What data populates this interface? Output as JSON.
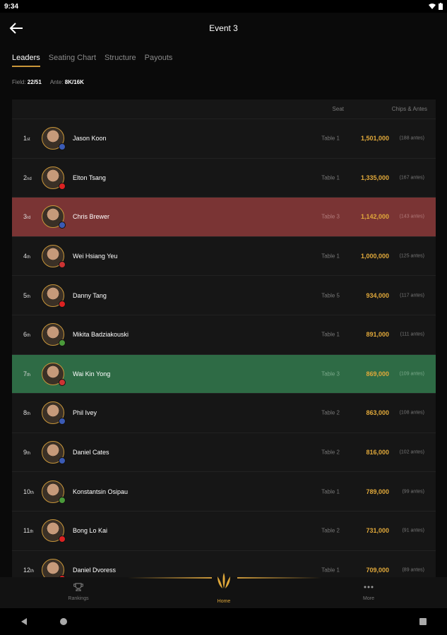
{
  "status": {
    "time": "9:34"
  },
  "header": {
    "title": "Event 3"
  },
  "tabs": [
    {
      "label": "Leaders"
    },
    {
      "label": "Seating Chart"
    },
    {
      "label": "Structure"
    },
    {
      "label": "Payouts"
    }
  ],
  "field": {
    "field_label": "Field:",
    "field_value": "22/51",
    "ante_label": "Ante:",
    "ante_value": "8K/16K"
  },
  "table": {
    "col_seat": "Seat",
    "col_chips": "Chips & Antes",
    "rows": [
      {
        "rank": "1",
        "suffix": "st",
        "name": "Jason Koon",
        "seat": "Table 1",
        "chips": "1,501,000",
        "antes": "(188 antes)",
        "flag": "#3b5bb5"
      },
      {
        "rank": "2",
        "suffix": "nd",
        "name": "Elton Tsang",
        "seat": "Table 1",
        "chips": "1,335,000",
        "antes": "(167 antes)",
        "flag": "#d22"
      },
      {
        "rank": "3",
        "suffix": "rd",
        "name": "Chris Brewer",
        "seat": "Table 3",
        "chips": "1,142,000",
        "antes": "(143 antes)",
        "flag": "#3b5bb5"
      },
      {
        "rank": "4",
        "suffix": "th",
        "name": "Wei Hsiang Yeu",
        "seat": "Table 1",
        "chips": "1,000,000",
        "antes": "(125 antes)",
        "flag": "#c33"
      },
      {
        "rank": "5",
        "suffix": "th",
        "name": "Danny Tang",
        "seat": "Table 5",
        "chips": "934,000",
        "antes": "(117 antes)",
        "flag": "#d22"
      },
      {
        "rank": "6",
        "suffix": "th",
        "name": "Mikita Badziakouski",
        "seat": "Table 1",
        "chips": "891,000",
        "antes": "(111 antes)",
        "flag": "#4a9a3a"
      },
      {
        "rank": "7",
        "suffix": "th",
        "name": "Wai Kin Yong",
        "seat": "Table 3",
        "chips": "869,000",
        "antes": "(109 antes)",
        "flag": "#c33"
      },
      {
        "rank": "8",
        "suffix": "th",
        "name": "Phil Ivey",
        "seat": "Table 2",
        "chips": "863,000",
        "antes": "(108 antes)",
        "flag": "#3b5bb5"
      },
      {
        "rank": "9",
        "suffix": "th",
        "name": "Daniel Cates",
        "seat": "Table 2",
        "chips": "816,000",
        "antes": "(102 antes)",
        "flag": "#3b5bb5"
      },
      {
        "rank": "10",
        "suffix": "th",
        "name": "Konstantsin Osipau",
        "seat": "Table 1",
        "chips": "789,000",
        "antes": "(99 antes)",
        "flag": "#4a9a3a"
      },
      {
        "rank": "11",
        "suffix": "th",
        "name": "Bong Lo Kai",
        "seat": "Table 2",
        "chips": "731,000",
        "antes": "(91 antes)",
        "flag": "#d22"
      },
      {
        "rank": "12",
        "suffix": "th",
        "name": "Daniel Dvoress",
        "seat": "Table 1",
        "chips": "709,000",
        "antes": "(89 antes)",
        "flag": "#d22"
      }
    ]
  },
  "bottom_nav": [
    {
      "label": "Rankings",
      "icon": "trophy-icon"
    },
    {
      "label": "Home",
      "icon": "home-logo-icon"
    },
    {
      "label": "More",
      "icon": "more-dots-icon"
    }
  ],
  "colors": {
    "accent": "#c9973a",
    "chips": "#e0a83a",
    "highlight_red": "#7a3434",
    "highlight_green": "#2e6b45"
  }
}
